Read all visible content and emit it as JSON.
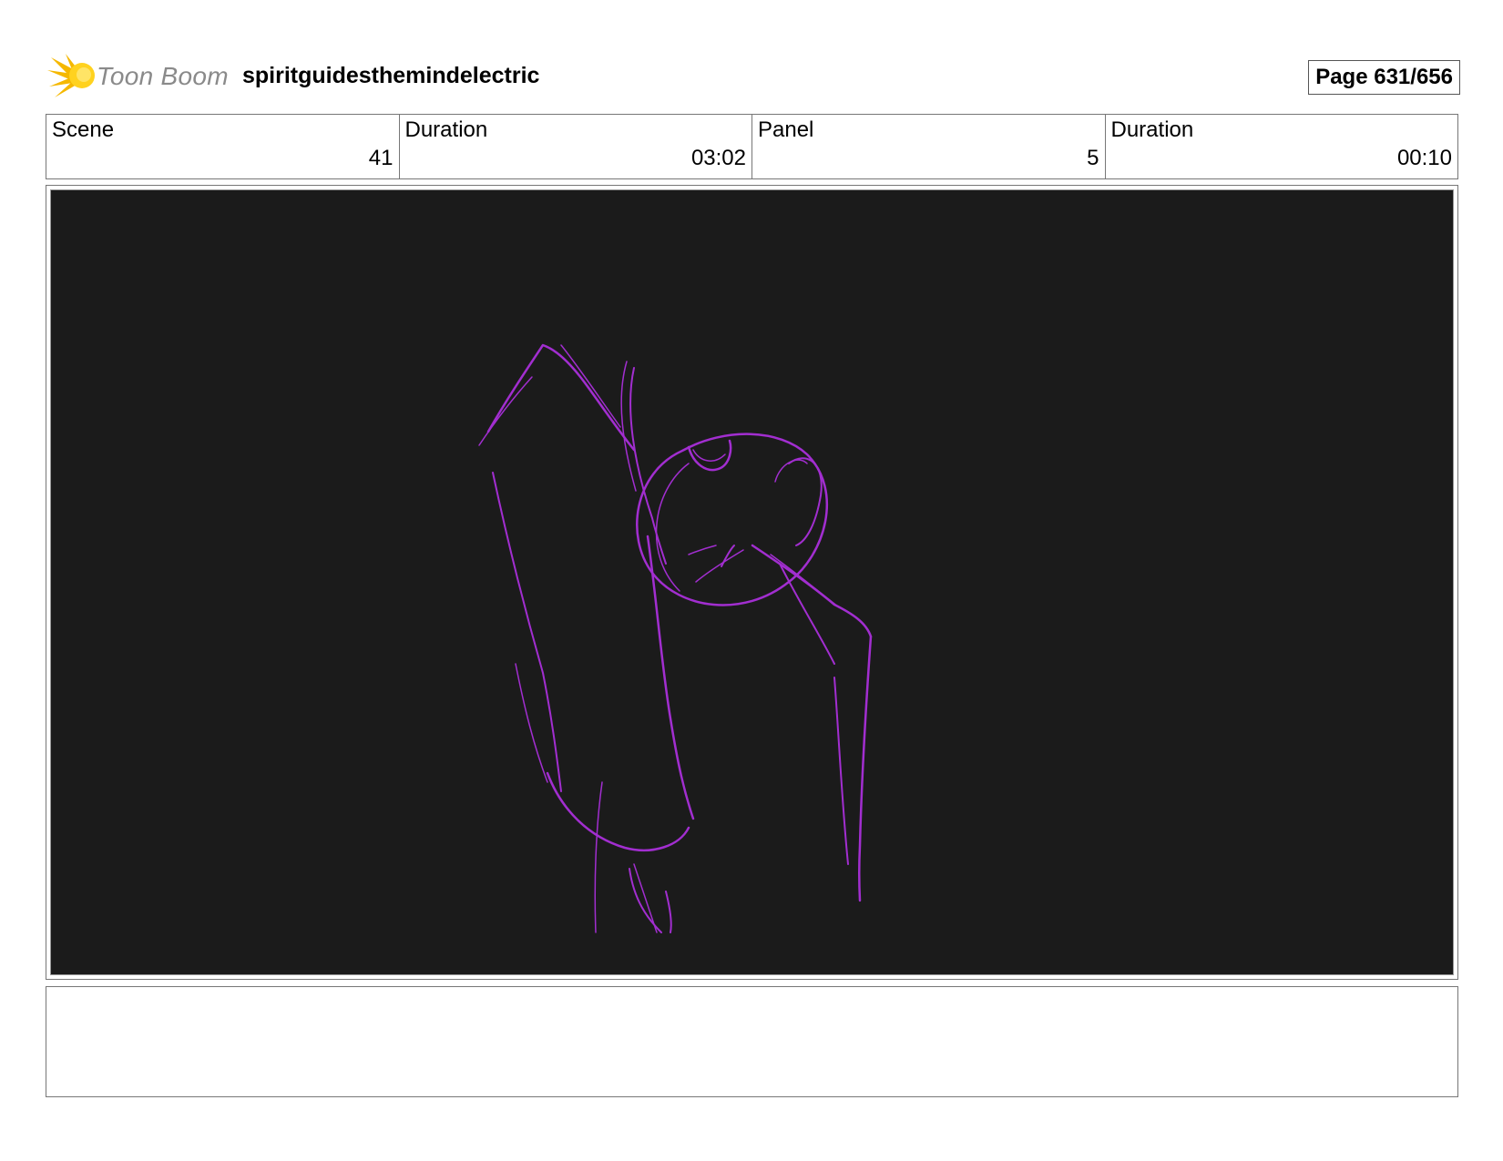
{
  "header": {
    "logo_text": "Toon Boom",
    "project_title": "spiritguidesthemindelectric",
    "page_label": "Page 631/656"
  },
  "info": {
    "scene": {
      "label": "Scene",
      "value": "41"
    },
    "scene_duration": {
      "label": "Duration",
      "value": "03:02"
    },
    "panel": {
      "label": "Panel",
      "value": "5"
    },
    "panel_duration": {
      "label": "Duration",
      "value": "00:10"
    }
  },
  "panel": {
    "background_color": "#1b1b1b",
    "sketch_color": "#a22ed0"
  },
  "notes": {
    "text": ""
  }
}
